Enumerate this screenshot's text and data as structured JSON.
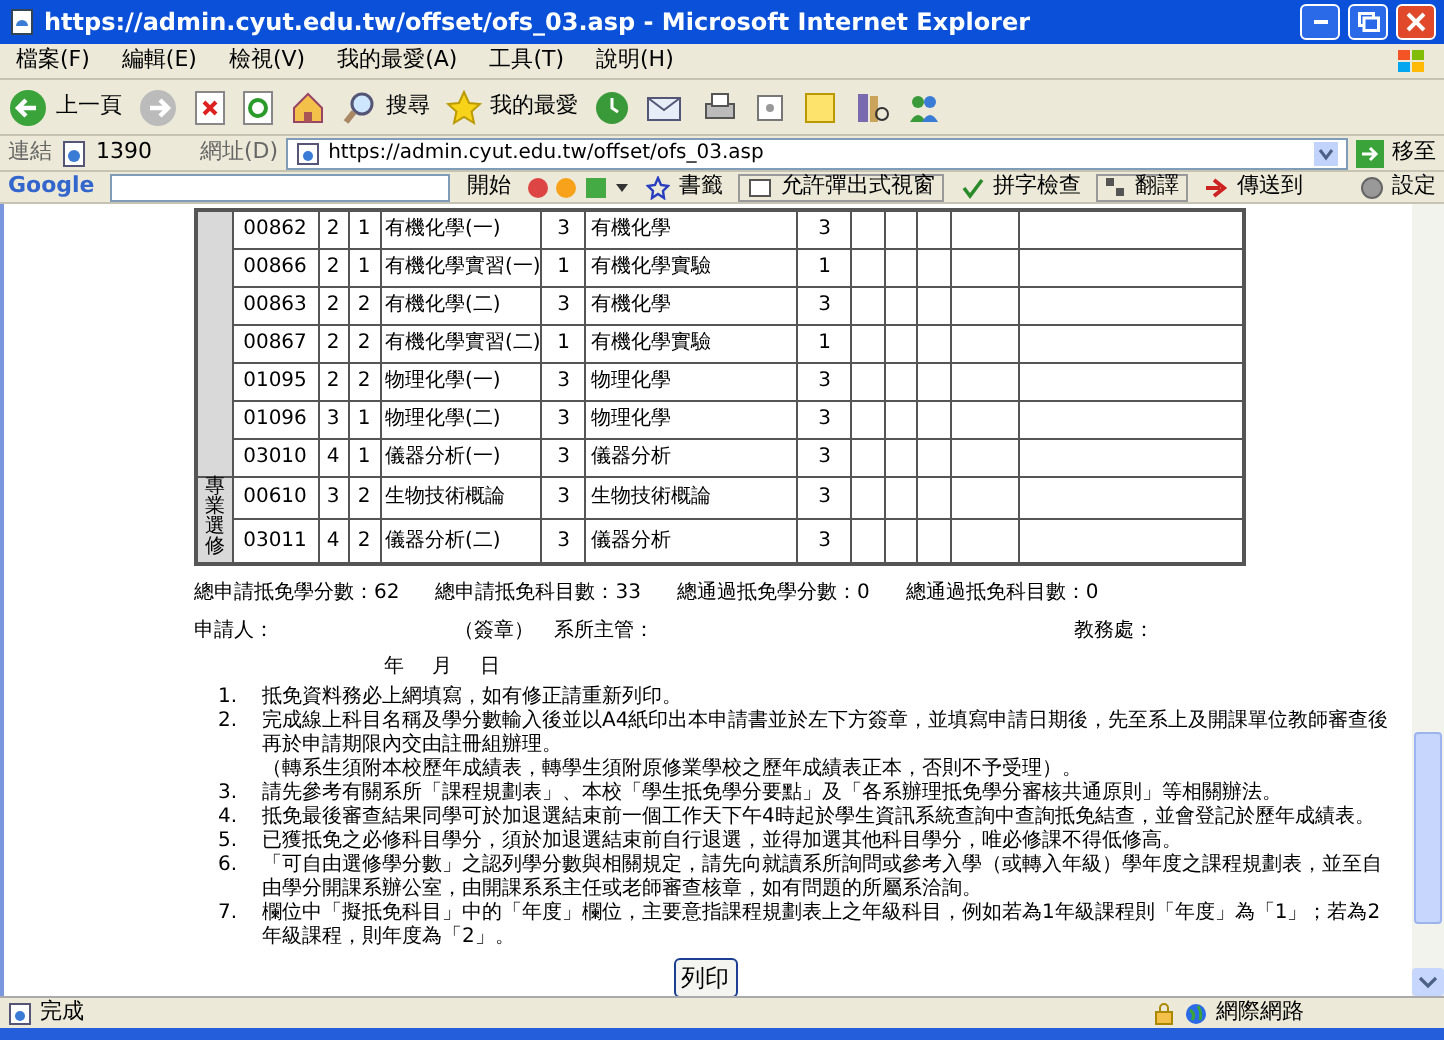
{
  "window": {
    "title": "https://admin.cyut.edu.tw/offset/ofs_03.asp - Microsoft Internet Explorer"
  },
  "menu": [
    "檔案(F)",
    "編輯(E)",
    "檢視(V)",
    "我的最愛(A)",
    "工具(T)",
    "說明(H)"
  ],
  "toolbar": {
    "back": "上一頁",
    "search": "搜尋",
    "favorites": "我的最愛"
  },
  "address_bar": {
    "links_label": "連結",
    "link": "1390",
    "label": "網址(D)",
    "url": "https://admin.cyut.edu.tw/offset/ofs_03.asp",
    "go": "移至"
  },
  "google_bar": {
    "logo": "Google",
    "search_button": "開始",
    "bookmarks": "書籤",
    "popup": "允許彈出式視窗",
    "spellcheck": "拼字檢查",
    "translate": "翻譯",
    "send": "傳送到",
    "settings": "設定"
  },
  "table": {
    "groups": [
      {
        "rows": [
          {
            "code": "00862",
            "year": "2",
            "semester": "1",
            "course": "有機化學(一)",
            "credits": "3",
            "equivalent": "有機化學",
            "equivalent_credits": "3"
          },
          {
            "code": "00866",
            "year": "2",
            "semester": "1",
            "course": "有機化學實習(一)",
            "credits": "1",
            "equivalent": "有機化學實驗",
            "equivalent_credits": "1"
          },
          {
            "code": "00863",
            "year": "2",
            "semester": "2",
            "course": "有機化學(二)",
            "credits": "3",
            "equivalent": "有機化學",
            "equivalent_credits": "3"
          },
          {
            "code": "00867",
            "year": "2",
            "semester": "2",
            "course": "有機化學實習(二)",
            "credits": "1",
            "equivalent": "有機化學實驗",
            "equivalent_credits": "1"
          },
          {
            "code": "01095",
            "year": "2",
            "semester": "2",
            "course": "物理化學(一)",
            "credits": "3",
            "equivalent": "物理化學",
            "equivalent_credits": "3"
          },
          {
            "code": "01096",
            "year": "3",
            "semester": "1",
            "course": "物理化學(二)",
            "credits": "3",
            "equivalent": "物理化學",
            "equivalent_credits": "3"
          },
          {
            "code": "03010",
            "year": "4",
            "semester": "1",
            "course": "儀器分析(一)",
            "credits": "3",
            "equivalent": "儀器分析",
            "equivalent_credits": "3"
          }
        ]
      },
      {
        "label": "專業選修",
        "rows": [
          {
            "code": "00610",
            "year": "3",
            "semester": "2",
            "course": "生物技術概論",
            "credits": "3",
            "equivalent": "生物技術概論",
            "equivalent_credits": "3"
          },
          {
            "code": "03011",
            "year": "4",
            "semester": "2",
            "course": "儀器分析(二)",
            "credits": "3",
            "equivalent": "儀器分析",
            "equivalent_credits": "3"
          }
        ]
      }
    ]
  },
  "totals": [
    "總申請抵免學分數：62",
    "總申請抵免科目數：33",
    "總通過抵免學分數：0",
    "總通過抵免科目數：0"
  ],
  "signatures": [
    "申請人：",
    "（簽章）",
    "系所主管：",
    "教務處："
  ],
  "date": [
    "年",
    "月",
    "日"
  ],
  "notes": [
    {
      "number": "1.",
      "lines": [
        "抵免資料務必上網填寫，如有修正請重新列印。"
      ]
    },
    {
      "number": "2.",
      "lines": [
        "完成線上科目名稱及學分數輸入後並以A4紙印出本申請書並於左下方簽章，並填寫申請日期後，先至系上及開課單位教師審查後再於申請期限內交由註冊組辦理。",
        "（轉系生須附本校歷年成績表，轉學生須附原修業學校之歷年成績表正本，否則不予受理）。"
      ]
    },
    {
      "number": "3.",
      "lines": [
        "請先參考有關系所「課程規劃表」、本校「學生抵免學分要點」及「各系辦理抵免學分審核共通原則」等相關辦法。"
      ]
    },
    {
      "number": "4.",
      "lines": [
        "抵免最後審查結果同學可於加退選結束前一個工作天下午4時起於學生資訊系統查詢中查詢抵免結查，並會登記於歷年成績表。"
      ]
    },
    {
      "number": "5.",
      "lines": [
        "已獲抵免之必修科目學分，須於加退選結束前自行退選，並得加選其他科目學分，唯必修課不得低修高。"
      ]
    },
    {
      "number": "6.",
      "lines": [
        "「可自由選修學分數」之認列學分數與相關規定，請先向就讀系所詢問或參考入學（或轉入年級）學年度之課程規劃表，並至自由學分開課系辦公室，由開課系系主任或老師審查核章，如有問題的所屬系洽詢。"
      ]
    },
    {
      "number": "7.",
      "lines": [
        "欄位中「擬抵免科目」中的「年度」欄位，主要意指課程規劃表上之年級科目，例如若為1年級課程則「年度」為「1」；若為2年級課程，則年度為「2」。"
      ]
    }
  ],
  "print_button": "列印",
  "status_bar": {
    "text": "完成",
    "zone": "網際網路"
  }
}
